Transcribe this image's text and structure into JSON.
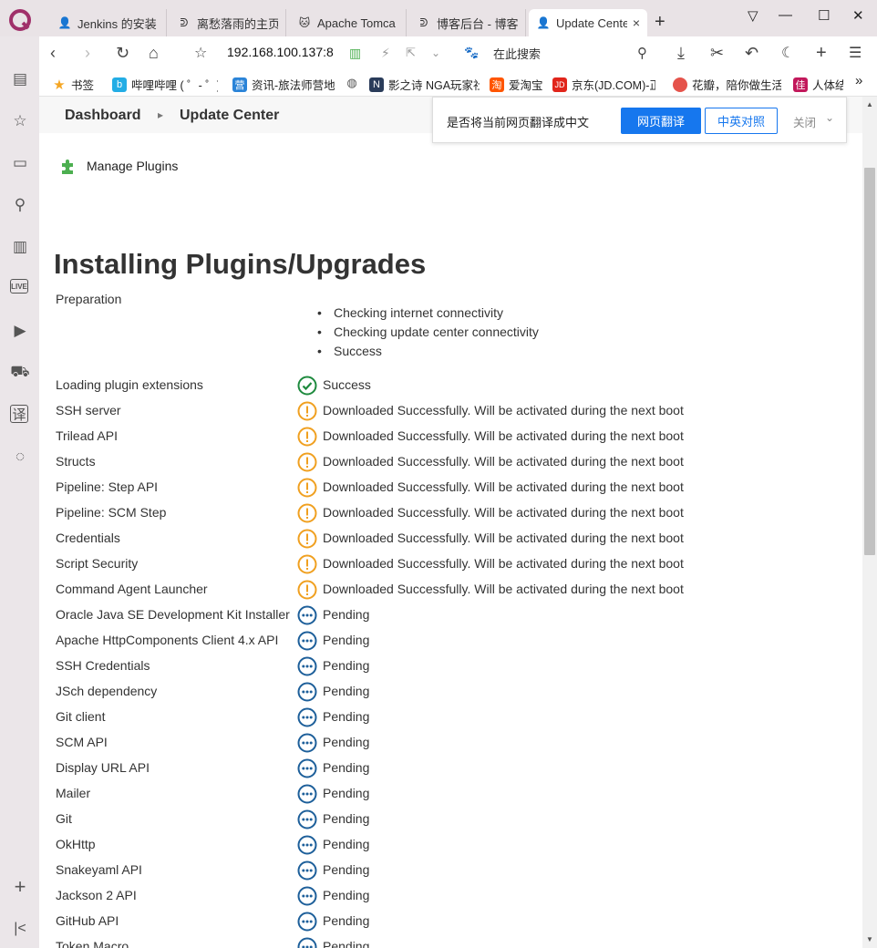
{
  "browser": {
    "tabs": [
      {
        "title": "Jenkins 的安装",
        "icon": "jenkins-favicon"
      },
      {
        "title": "离愁落雨的主页",
        "icon": "cnblogs-favicon"
      },
      {
        "title": "Apache Tomca",
        "icon": "tomcat-favicon"
      },
      {
        "title": "博客后台 - 博客",
        "icon": "cnblogs-favicon"
      },
      {
        "title": "Update Cente",
        "icon": "jenkins-favicon"
      }
    ],
    "close_glyph": "×",
    "new_tab_glyph": "+",
    "url": "192.168.100.137:8",
    "search_placeholder": "在此搜索",
    "bookmarks": [
      {
        "label": "书签",
        "color": "#f5a623",
        "glyph": "★"
      },
      {
        "label": "哔哩哔哩 ( ゜- ゜)つ",
        "color": "#23ade5",
        "glyph": "b"
      },
      {
        "label": "资讯-旅法师营地",
        "color": "#2b84d8",
        "glyph": "营"
      },
      {
        "label": "影之诗 NGA玩家社",
        "color": "#2a3c5a",
        "glyph": "N"
      },
      {
        "label": "爱淘宝",
        "color": "#ff5500",
        "glyph": "淘"
      },
      {
        "label": "京东(JD.COM)-正",
        "color": "#e1251b",
        "glyph": "JD"
      },
      {
        "label": "花瓣，陪你做生活",
        "color": "#e5534b",
        "glyph": "花"
      },
      {
        "label": "人体结",
        "color": "#c2185b",
        "glyph": "佳"
      }
    ],
    "more_bookmarks_glyph": "»"
  },
  "breadcrumb": {
    "dashboard": "Dashboard",
    "separator": "▸",
    "current": "Update Center"
  },
  "translate_bar": {
    "prompt": "是否将当前网页翻译成中文",
    "translate_button": "网页翻译",
    "compare_button": "中英对照",
    "close": "关闭",
    "chevron": "⌄"
  },
  "sidebar_link": {
    "label": "Manage Plugins"
  },
  "page_title": "Installing Plugins/Upgrades",
  "preparation": {
    "label": "Preparation",
    "steps": [
      "Checking internet connectivity",
      "Checking update center connectivity",
      "Success"
    ]
  },
  "colors": {
    "success": "#1e8a3e",
    "warning": "#f0a020",
    "pending": "#1d5f9a",
    "accent": "#1677ee"
  },
  "plugins": [
    {
      "name": "Loading plugin extensions",
      "status": "success",
      "text": "Success"
    },
    {
      "name": "SSH server",
      "status": "warning",
      "text": "Downloaded Successfully. Will be activated during the next boot"
    },
    {
      "name": "Trilead API",
      "status": "warning",
      "text": "Downloaded Successfully. Will be activated during the next boot"
    },
    {
      "name": "Structs",
      "status": "warning",
      "text": "Downloaded Successfully. Will be activated during the next boot"
    },
    {
      "name": "Pipeline: Step API",
      "status": "warning",
      "text": "Downloaded Successfully. Will be activated during the next boot"
    },
    {
      "name": "Pipeline: SCM Step",
      "status": "warning",
      "text": "Downloaded Successfully. Will be activated during the next boot"
    },
    {
      "name": "Credentials",
      "status": "warning",
      "text": "Downloaded Successfully. Will be activated during the next boot"
    },
    {
      "name": "Script Security",
      "status": "warning",
      "text": "Downloaded Successfully. Will be activated during the next boot"
    },
    {
      "name": "Command Agent Launcher",
      "status": "warning",
      "text": "Downloaded Successfully. Will be activated during the next boot"
    },
    {
      "name": "Oracle Java SE Development Kit Installer",
      "status": "pending",
      "text": "Pending"
    },
    {
      "name": "Apache HttpComponents Client 4.x API",
      "status": "pending",
      "text": "Pending"
    },
    {
      "name": "SSH Credentials",
      "status": "pending",
      "text": "Pending"
    },
    {
      "name": "JSch dependency",
      "status": "pending",
      "text": "Pending"
    },
    {
      "name": "Git client",
      "status": "pending",
      "text": "Pending"
    },
    {
      "name": "SCM API",
      "status": "pending",
      "text": "Pending"
    },
    {
      "name": "Display URL API",
      "status": "pending",
      "text": "Pending"
    },
    {
      "name": "Mailer",
      "status": "pending",
      "text": "Pending"
    },
    {
      "name": "Git",
      "status": "pending",
      "text": "Pending"
    },
    {
      "name": "OkHttp",
      "status": "pending",
      "text": "Pending"
    },
    {
      "name": "Snakeyaml API",
      "status": "pending",
      "text": "Pending"
    },
    {
      "name": "Jackson 2 API",
      "status": "pending",
      "text": "Pending"
    },
    {
      "name": "GitHub API",
      "status": "pending",
      "text": "Pending"
    },
    {
      "name": "Token Macro",
      "status": "pending",
      "text": "Pending"
    }
  ]
}
